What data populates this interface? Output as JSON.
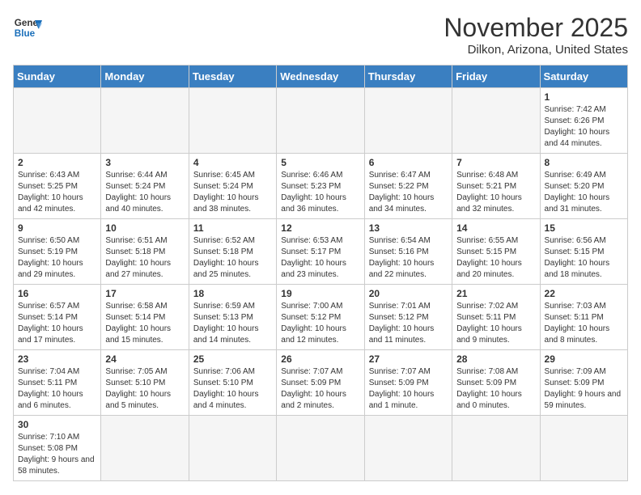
{
  "logo": {
    "line1": "General",
    "line2": "Blue"
  },
  "title": "November 2025",
  "subtitle": "Dilkon, Arizona, United States",
  "days_of_week": [
    "Sunday",
    "Monday",
    "Tuesday",
    "Wednesday",
    "Thursday",
    "Friday",
    "Saturday"
  ],
  "weeks": [
    [
      {
        "day": "",
        "info": ""
      },
      {
        "day": "",
        "info": ""
      },
      {
        "day": "",
        "info": ""
      },
      {
        "day": "",
        "info": ""
      },
      {
        "day": "",
        "info": ""
      },
      {
        "day": "",
        "info": ""
      },
      {
        "day": "1",
        "info": "Sunrise: 7:42 AM\nSunset: 6:26 PM\nDaylight: 10 hours and 44 minutes."
      }
    ],
    [
      {
        "day": "2",
        "info": "Sunrise: 6:43 AM\nSunset: 5:25 PM\nDaylight: 10 hours and 42 minutes."
      },
      {
        "day": "3",
        "info": "Sunrise: 6:44 AM\nSunset: 5:24 PM\nDaylight: 10 hours and 40 minutes."
      },
      {
        "day": "4",
        "info": "Sunrise: 6:45 AM\nSunset: 5:24 PM\nDaylight: 10 hours and 38 minutes."
      },
      {
        "day": "5",
        "info": "Sunrise: 6:46 AM\nSunset: 5:23 PM\nDaylight: 10 hours and 36 minutes."
      },
      {
        "day": "6",
        "info": "Sunrise: 6:47 AM\nSunset: 5:22 PM\nDaylight: 10 hours and 34 minutes."
      },
      {
        "day": "7",
        "info": "Sunrise: 6:48 AM\nSunset: 5:21 PM\nDaylight: 10 hours and 32 minutes."
      },
      {
        "day": "8",
        "info": "Sunrise: 6:49 AM\nSunset: 5:20 PM\nDaylight: 10 hours and 31 minutes."
      }
    ],
    [
      {
        "day": "9",
        "info": "Sunrise: 6:50 AM\nSunset: 5:19 PM\nDaylight: 10 hours and 29 minutes."
      },
      {
        "day": "10",
        "info": "Sunrise: 6:51 AM\nSunset: 5:18 PM\nDaylight: 10 hours and 27 minutes."
      },
      {
        "day": "11",
        "info": "Sunrise: 6:52 AM\nSunset: 5:18 PM\nDaylight: 10 hours and 25 minutes."
      },
      {
        "day": "12",
        "info": "Sunrise: 6:53 AM\nSunset: 5:17 PM\nDaylight: 10 hours and 23 minutes."
      },
      {
        "day": "13",
        "info": "Sunrise: 6:54 AM\nSunset: 5:16 PM\nDaylight: 10 hours and 22 minutes."
      },
      {
        "day": "14",
        "info": "Sunrise: 6:55 AM\nSunset: 5:15 PM\nDaylight: 10 hours and 20 minutes."
      },
      {
        "day": "15",
        "info": "Sunrise: 6:56 AM\nSunset: 5:15 PM\nDaylight: 10 hours and 18 minutes."
      }
    ],
    [
      {
        "day": "16",
        "info": "Sunrise: 6:57 AM\nSunset: 5:14 PM\nDaylight: 10 hours and 17 minutes."
      },
      {
        "day": "17",
        "info": "Sunrise: 6:58 AM\nSunset: 5:14 PM\nDaylight: 10 hours and 15 minutes."
      },
      {
        "day": "18",
        "info": "Sunrise: 6:59 AM\nSunset: 5:13 PM\nDaylight: 10 hours and 14 minutes."
      },
      {
        "day": "19",
        "info": "Sunrise: 7:00 AM\nSunset: 5:12 PM\nDaylight: 10 hours and 12 minutes."
      },
      {
        "day": "20",
        "info": "Sunrise: 7:01 AM\nSunset: 5:12 PM\nDaylight: 10 hours and 11 minutes."
      },
      {
        "day": "21",
        "info": "Sunrise: 7:02 AM\nSunset: 5:11 PM\nDaylight: 10 hours and 9 minutes."
      },
      {
        "day": "22",
        "info": "Sunrise: 7:03 AM\nSunset: 5:11 PM\nDaylight: 10 hours and 8 minutes."
      }
    ],
    [
      {
        "day": "23",
        "info": "Sunrise: 7:04 AM\nSunset: 5:11 PM\nDaylight: 10 hours and 6 minutes."
      },
      {
        "day": "24",
        "info": "Sunrise: 7:05 AM\nSunset: 5:10 PM\nDaylight: 10 hours and 5 minutes."
      },
      {
        "day": "25",
        "info": "Sunrise: 7:06 AM\nSunset: 5:10 PM\nDaylight: 10 hours and 4 minutes."
      },
      {
        "day": "26",
        "info": "Sunrise: 7:07 AM\nSunset: 5:09 PM\nDaylight: 10 hours and 2 minutes."
      },
      {
        "day": "27",
        "info": "Sunrise: 7:07 AM\nSunset: 5:09 PM\nDaylight: 10 hours and 1 minute."
      },
      {
        "day": "28",
        "info": "Sunrise: 7:08 AM\nSunset: 5:09 PM\nDaylight: 10 hours and 0 minutes."
      },
      {
        "day": "29",
        "info": "Sunrise: 7:09 AM\nSunset: 5:09 PM\nDaylight: 9 hours and 59 minutes."
      }
    ],
    [
      {
        "day": "30",
        "info": "Sunrise: 7:10 AM\nSunset: 5:08 PM\nDaylight: 9 hours and 58 minutes."
      },
      {
        "day": "",
        "info": ""
      },
      {
        "day": "",
        "info": ""
      },
      {
        "day": "",
        "info": ""
      },
      {
        "day": "",
        "info": ""
      },
      {
        "day": "",
        "info": ""
      },
      {
        "day": "",
        "info": ""
      }
    ]
  ]
}
